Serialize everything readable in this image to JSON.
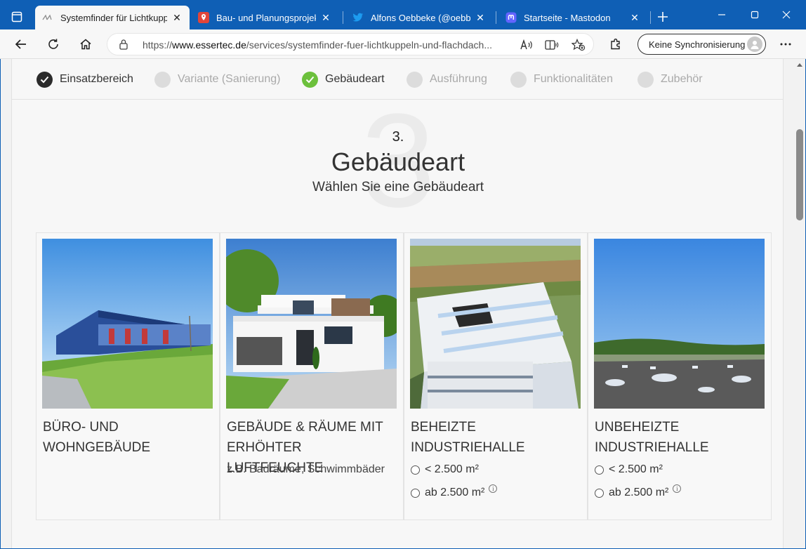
{
  "browser": {
    "tabs": [
      {
        "title": "Systemfinder für Lichtkuppe",
        "active": true,
        "icon": "essertec-favicon"
      },
      {
        "title": "Bau- und Planungsprojekte",
        "active": false,
        "icon": "map-pin-favicon"
      },
      {
        "title": "Alfons Oebbeke (@oebbeke",
        "active": false,
        "icon": "twitter-favicon"
      },
      {
        "title": "Startseite - Mastodon",
        "active": false,
        "icon": "mastodon-favicon"
      }
    ],
    "url_prefix": "https://",
    "url_domain": "www.essertec.de",
    "url_path": "/services/systemfinder-fuer-lichtkuppeln-und-flachdach...",
    "sync_label": "Keine Synchronisierung",
    "colors": {
      "frame": "#0f5fb5",
      "toolbar": "#f7f7f7"
    }
  },
  "steps": [
    {
      "label": "Einsatzbereich",
      "state": "done"
    },
    {
      "label": "Variante (Sanierung)",
      "state": "inactive"
    },
    {
      "label": "Gebäudeart",
      "state": "current"
    },
    {
      "label": "Ausführung",
      "state": "inactive"
    },
    {
      "label": "Funktionalitäten",
      "state": "inactive"
    },
    {
      "label": "Zubehör",
      "state": "inactive"
    }
  ],
  "section": {
    "background_number": "3",
    "number": "3.",
    "title": "Gebäudeart",
    "subtitle": "Wählen Sie eine Gebäudeart"
  },
  "cards": [
    {
      "name_line1": "BÜRO- UND",
      "name_line2": "WOHNGEBÄUDE"
    },
    {
      "name_line1": "GEBÄUDE & RÄUME MIT",
      "name_line2": "ERHÖHTER LUFTFEUCHTE",
      "note": "z.B. Badräume, Schwimmbäder"
    },
    {
      "name_line1": "BEHEIZTE",
      "name_line2": "INDUSTRIEHALLE",
      "options": [
        "< 2.500 m²",
        "ab 2.500 m²"
      ]
    },
    {
      "name_line1": "UNBEHEIZTE",
      "name_line2": "INDUSTRIEHALLE",
      "options": [
        "< 2.500 m²",
        "ab 2.500 m²"
      ]
    }
  ],
  "colors": {
    "accent_green": "#6cc03c",
    "step_done": "#2b2b2b",
    "step_inactive": "#dcdcdc"
  }
}
